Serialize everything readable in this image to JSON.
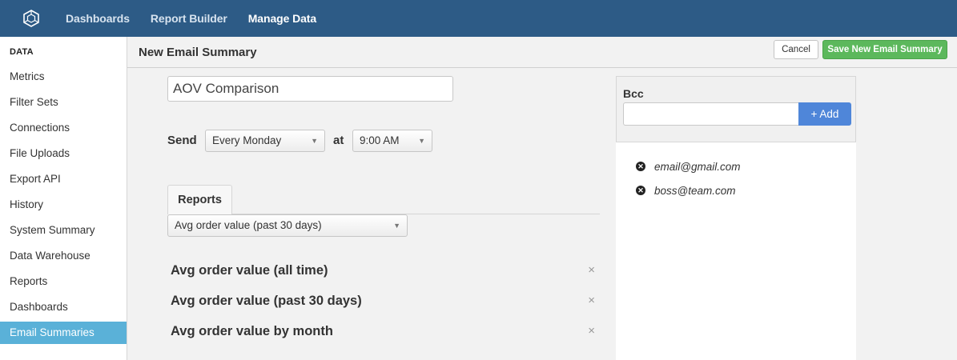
{
  "nav": {
    "logo_icon": "hexagon-logo-icon",
    "links": [
      "Dashboards",
      "Report Builder",
      "Manage Data"
    ],
    "active": "Manage Data"
  },
  "sidebar": {
    "heading": "DATA",
    "items": [
      {
        "label": "Metrics"
      },
      {
        "label": "Filter Sets"
      },
      {
        "label": "Connections"
      },
      {
        "label": "File Uploads"
      },
      {
        "label": "Export API"
      },
      {
        "label": "History"
      },
      {
        "label": "System Summary"
      },
      {
        "label": "Data Warehouse"
      },
      {
        "label": "Reports"
      },
      {
        "label": "Dashboards"
      },
      {
        "label": "Email Summaries",
        "active": true
      }
    ]
  },
  "header": {
    "title": "New Email Summary",
    "cancel_label": "Cancel",
    "save_label": "Save New Email Summary"
  },
  "form": {
    "name_value": "AOV Comparison",
    "send_label": "Send",
    "frequency": "Every Monday",
    "at_label": "at",
    "time": "9:00 AM",
    "reports_tab": "Reports",
    "report_select": "Avg order value (past 30 days)",
    "reports": [
      {
        "name": "Avg order value (all time)"
      },
      {
        "name": "Avg order value (past 30 days)"
      },
      {
        "name": "Avg order value by month"
      }
    ]
  },
  "bcc": {
    "label": "Bcc",
    "input_value": "",
    "add_label": "+ Add",
    "emails": [
      "email@gmail.com",
      "boss@team.com"
    ]
  },
  "colors": {
    "nav_bg": "#2d5b86",
    "active_sidebar": "#5ab1d8",
    "save_button": "#5cb85c",
    "add_button": "#4f86d9"
  }
}
